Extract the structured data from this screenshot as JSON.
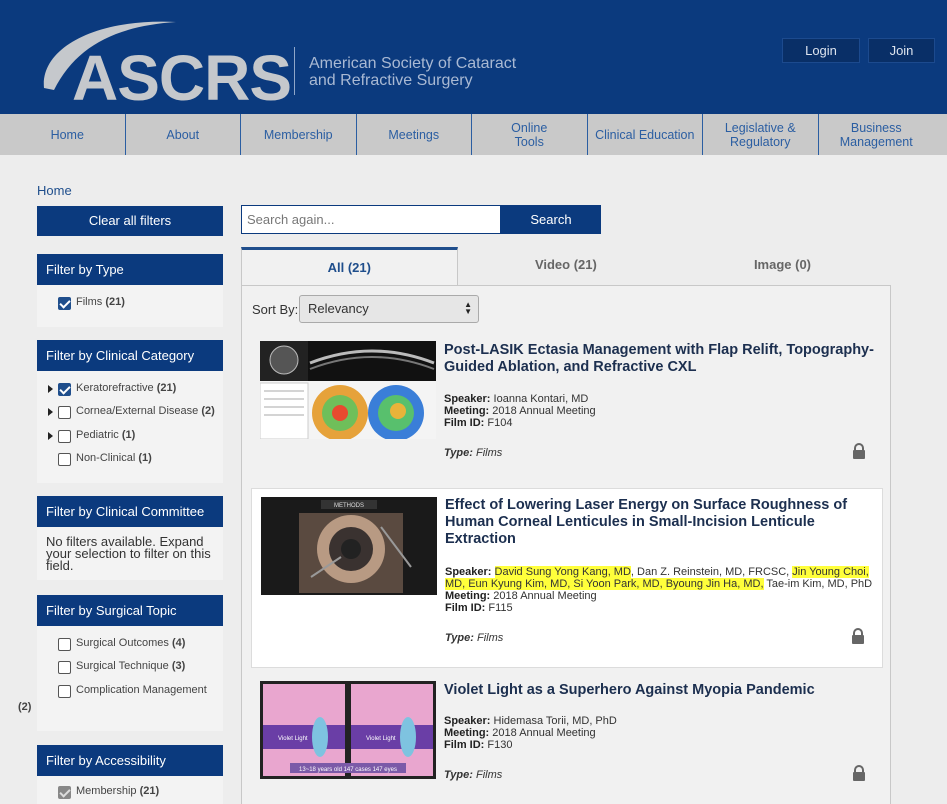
{
  "header": {
    "logo": "ASCRS",
    "tagline_line1": "American Society of Cataract",
    "tagline_line2": "and Refractive Surgery",
    "login": "Login",
    "join": "Join"
  },
  "nav": [
    "Home",
    "About",
    "Membership",
    "Meetings",
    "Online\nTools",
    "Clinical Education",
    "Legislative &\nRegulatory",
    "Business\nManagement"
  ],
  "breadcrumb": "Home",
  "clear_filters": "Clear all filters",
  "filters": {
    "type": {
      "title": "Filter by Type",
      "items": [
        {
          "label": "Films",
          "count": "(21)"
        }
      ]
    },
    "clinical_category": {
      "title": "Filter by Clinical Category",
      "items": [
        {
          "label": "Keratorefractive",
          "count": "(21)"
        },
        {
          "label": "Cornea/External Disease",
          "count": "(2)"
        },
        {
          "label": "Pediatric",
          "count": "(1)"
        },
        {
          "label": "Non-Clinical",
          "count": "(1)"
        }
      ]
    },
    "clinical_committee": {
      "title": "Filter by Clinical Committee",
      "text": "No filters available. Expand your selection to filter on this field."
    },
    "surgical_topic": {
      "title": "Filter by Surgical Topic",
      "items": [
        {
          "label": "Surgical Outcomes",
          "count": "(4)"
        },
        {
          "label": "Surgical Technique",
          "count": "(3)"
        },
        {
          "label": "Complication Management",
          "count": "(2)"
        }
      ]
    },
    "accessibility": {
      "title": "Filter by Accessibility",
      "items": [
        {
          "label": "Membership",
          "count": "(21)"
        }
      ]
    }
  },
  "search": {
    "placeholder": "Search again...",
    "button": "Search"
  },
  "tabs": [
    "All (21)",
    "Video (21)",
    "Image (0)"
  ],
  "sort": {
    "label": "Sort By:",
    "value": "Relevancy"
  },
  "results": [
    {
      "title": "Post-LASIK Ectasia Management with Flap Relift, Topography-Guided Ablation, and Refractive CXL",
      "speaker": "Ioanna Kontari, MD",
      "meeting": "2018 Annual Meeting",
      "film_id": "F104",
      "type": "Films"
    },
    {
      "title": "Effect of Lowering Laser Energy on Surface Roughness of Human Corneal Lenticules in Small-Incision Lenticule Extraction",
      "speaker_hl1": "David Sung Yong Kang, MD",
      "speaker_mid": ", Dan Z. Reinstein, MD, FRCSC, ",
      "speaker_hl2": "Jin Young Choi, MD, Eun Kyung Kim, MD, Si Yoon Park, MD, Byoung Jin Ha, MD,",
      "speaker_end": " Tae-im Kim, MD, PhD",
      "meeting": "2018 Annual Meeting",
      "film_id": "F115",
      "type": "Films",
      "thumb_label": "METHODS"
    },
    {
      "title": "Violet Light as a Superhero Against Myopia Pandemic",
      "speaker": "Hidemasa Torii, MD, PhD",
      "meeting": "2018 Annual Meeting",
      "film_id": "F130",
      "type": "Films",
      "thumb_label_left": "Violet Light",
      "thumb_label_right": "Violet Light",
      "thumb_caption": "13~18 years old 147 cases 147 eyes"
    }
  ],
  "labels": {
    "speaker": "Speaker:",
    "meeting": "Meeting:",
    "film_id": "Film ID:",
    "type": "Type:"
  }
}
